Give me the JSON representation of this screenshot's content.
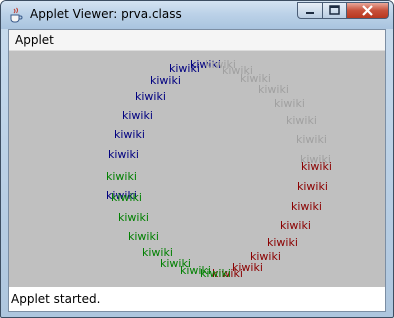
{
  "window": {
    "title": "Applet Viewer: prva.class"
  },
  "menu": {
    "items": [
      "Applet"
    ]
  },
  "status": {
    "text": "Applet started."
  },
  "applet": {
    "word": "kiwiki",
    "colors": {
      "blue": "#000080",
      "gray": "#a0a0a0",
      "red": "#8b0000",
      "green": "#008000",
      "background": "#c0c0c0"
    }
  }
}
